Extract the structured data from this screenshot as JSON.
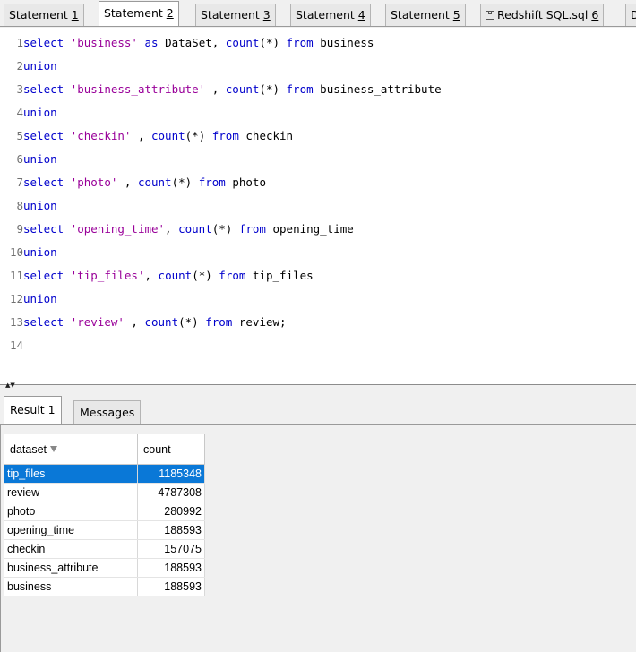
{
  "statement_tabs": [
    {
      "prefix": "Statement ",
      "num": "1"
    },
    {
      "prefix": "Statement ",
      "num": "2"
    },
    {
      "prefix": "Statement ",
      "num": "3"
    },
    {
      "prefix": "Statement ",
      "num": "4"
    },
    {
      "prefix": "Statement ",
      "num": "5"
    },
    {
      "prefix": "Redshift SQL.sql ",
      "num": "6"
    },
    {
      "prefix": "D",
      "num": ""
    }
  ],
  "active_statement_tab": 1,
  "code": [
    {
      "n": "1",
      "tokens": [
        [
          "kw",
          "select "
        ],
        [
          "str",
          "'business'"
        ],
        [
          "kw",
          " as "
        ],
        [
          "plain",
          "DataSet, "
        ],
        [
          "fn",
          "count"
        ],
        [
          "plain",
          "(*) "
        ],
        [
          "kw",
          "from "
        ],
        [
          "plain",
          "business"
        ]
      ]
    },
    {
      "n": "2",
      "tokens": [
        [
          "kw",
          "union"
        ]
      ]
    },
    {
      "n": "3",
      "tokens": [
        [
          "kw",
          "select "
        ],
        [
          "str",
          "'business_attribute'"
        ],
        [
          "plain",
          " , "
        ],
        [
          "fn",
          "count"
        ],
        [
          "plain",
          "(*) "
        ],
        [
          "kw",
          "from "
        ],
        [
          "plain",
          "business_attribute"
        ]
      ]
    },
    {
      "n": "4",
      "tokens": [
        [
          "kw",
          "union"
        ]
      ]
    },
    {
      "n": "5",
      "tokens": [
        [
          "kw",
          "select "
        ],
        [
          "str",
          "'checkin'"
        ],
        [
          "plain",
          " , "
        ],
        [
          "fn",
          "count"
        ],
        [
          "plain",
          "(*) "
        ],
        [
          "kw",
          "from "
        ],
        [
          "plain",
          "checkin"
        ]
      ]
    },
    {
      "n": "6",
      "tokens": [
        [
          "kw",
          "union"
        ]
      ]
    },
    {
      "n": "7",
      "tokens": [
        [
          "kw",
          "select "
        ],
        [
          "str",
          "'photo'"
        ],
        [
          "plain",
          " , "
        ],
        [
          "fn",
          "count"
        ],
        [
          "plain",
          "(*) "
        ],
        [
          "kw",
          "from "
        ],
        [
          "plain",
          "photo"
        ]
      ]
    },
    {
      "n": "8",
      "tokens": [
        [
          "kw",
          "union"
        ]
      ]
    },
    {
      "n": "9",
      "tokens": [
        [
          "kw",
          "select "
        ],
        [
          "str",
          "'opening_time'"
        ],
        [
          "plain",
          ", "
        ],
        [
          "fn",
          "count"
        ],
        [
          "plain",
          "(*) "
        ],
        [
          "kw",
          "from "
        ],
        [
          "plain",
          "opening_time"
        ]
      ]
    },
    {
      "n": "10",
      "tokens": [
        [
          "kw",
          "union"
        ]
      ]
    },
    {
      "n": "11",
      "tokens": [
        [
          "kw",
          "select "
        ],
        [
          "str",
          "'tip_files'"
        ],
        [
          "plain",
          ", "
        ],
        [
          "fn",
          "count"
        ],
        [
          "plain",
          "(*) "
        ],
        [
          "kw",
          "from "
        ],
        [
          "plain",
          "tip_files"
        ]
      ]
    },
    {
      "n": "12",
      "tokens": [
        [
          "kw",
          "union"
        ]
      ]
    },
    {
      "n": "13",
      "tokens": [
        [
          "kw",
          "select "
        ],
        [
          "str",
          "'review'"
        ],
        [
          "plain",
          " , "
        ],
        [
          "fn",
          "count"
        ],
        [
          "plain",
          "(*) "
        ],
        [
          "kw",
          "from "
        ],
        [
          "plain",
          "review;"
        ]
      ]
    },
    {
      "n": "14",
      "tokens": []
    }
  ],
  "result_tabs": {
    "result": "Result 1",
    "messages": "Messages"
  },
  "grid": {
    "columns": [
      "dataset",
      "count"
    ],
    "rows": [
      [
        "tip_files",
        "1185348"
      ],
      [
        "review",
        "4787308"
      ],
      [
        "photo",
        "280992"
      ],
      [
        "opening_time",
        "188593"
      ],
      [
        "checkin",
        "157075"
      ],
      [
        "business_attribute",
        "188593"
      ],
      [
        "business",
        "188593"
      ]
    ],
    "selected_row": 0
  }
}
